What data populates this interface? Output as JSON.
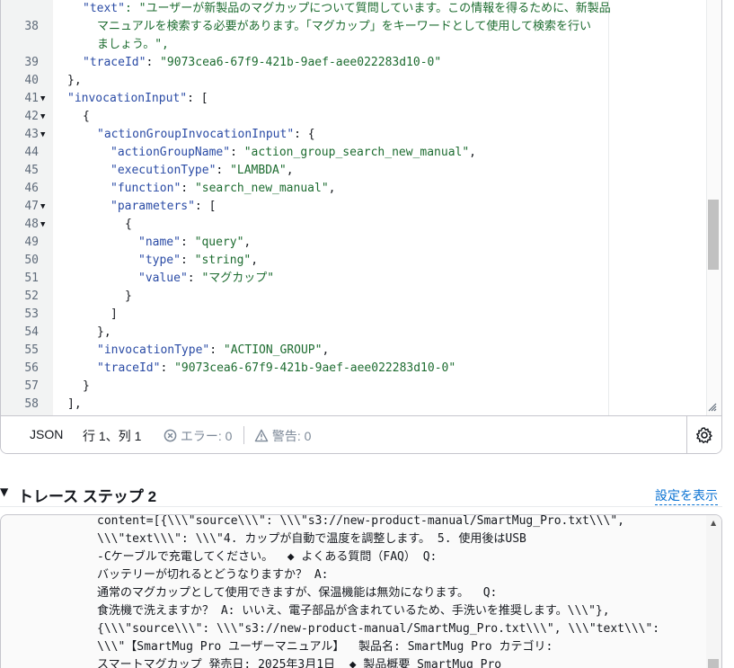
{
  "editor": {
    "wrapped_text_key": "\"text\"",
    "wrapped_text_1": ": \"ユーザーが新製品のマグカップについて質問しています。この情報を得るために、新製品",
    "wrapped_text_2": "マニュアルを検索する必要があります。「マグカップ」をキーワードとして使用して検索を行い",
    "wrapped_text_3": "ましょう。\",",
    "lines": [
      {
        "n": "38",
        "fold": ""
      },
      {
        "n": "39",
        "fold": "",
        "key": "\"traceId\"",
        "sep": ": ",
        "val": "\"9073cea6-67f9-421b-9aef-aee022283d10-0\"",
        "tail": ""
      },
      {
        "n": "40",
        "fold": "",
        "punct": "},"
      },
      {
        "n": "41",
        "fold": "▼",
        "key": "\"invocationInput\"",
        "sep": ": [",
        "val": "",
        "tail": ""
      },
      {
        "n": "42",
        "fold": "▼",
        "punct": "{"
      },
      {
        "n": "43",
        "fold": "▼",
        "key": "\"actionGroupInvocationInput\"",
        "sep": ": {",
        "val": "",
        "tail": ""
      },
      {
        "n": "44",
        "fold": "",
        "key": "\"actionGroupName\"",
        "sep": ": ",
        "val": "\"action_group_search_new_manual\"",
        "tail": ","
      },
      {
        "n": "45",
        "fold": "",
        "key": "\"executionType\"",
        "sep": ": ",
        "val": "\"LAMBDA\"",
        "tail": ","
      },
      {
        "n": "46",
        "fold": "",
        "key": "\"function\"",
        "sep": ": ",
        "val": "\"search_new_manual\"",
        "tail": ","
      },
      {
        "n": "47",
        "fold": "▼",
        "key": "\"parameters\"",
        "sep": ": [",
        "val": "",
        "tail": ""
      },
      {
        "n": "48",
        "fold": "▼",
        "punct": "{"
      },
      {
        "n": "49",
        "fold": "",
        "key": "\"name\"",
        "sep": ": ",
        "val": "\"query\"",
        "tail": ","
      },
      {
        "n": "50",
        "fold": "",
        "key": "\"type\"",
        "sep": ": ",
        "val": "\"string\"",
        "tail": ","
      },
      {
        "n": "51",
        "fold": "",
        "key": "\"value\"",
        "sep": ": ",
        "val": "\"マグカップ\"",
        "tail": ""
      },
      {
        "n": "52",
        "fold": "",
        "punct": "}"
      },
      {
        "n": "53",
        "fold": "",
        "punct": "]"
      },
      {
        "n": "54",
        "fold": "",
        "punct": "},"
      },
      {
        "n": "55",
        "fold": "",
        "key": "\"invocationType\"",
        "sep": ": ",
        "val": "\"ACTION_GROUP\"",
        "tail": ","
      },
      {
        "n": "56",
        "fold": "",
        "key": "\"traceId\"",
        "sep": ": ",
        "val": "\"9073cea6-67f9-421b-9aef-aee022283d10-0\"",
        "tail": ""
      },
      {
        "n": "57",
        "fold": "",
        "punct": "}"
      },
      {
        "n": "58",
        "fold": "",
        "punct": "],"
      }
    ]
  },
  "statusbar": {
    "mode": "JSON",
    "position": "行 1、列 1",
    "errors": "エラー: 0",
    "warnings": "警告: 0"
  },
  "trace_step": {
    "title": "トレース ステップ 2",
    "settings_link": "設定を表示",
    "log_lines": [
      "content=[{\\\\\\\"source\\\\\\\": \\\\\\\"s3://new-product-manual/SmartMug_Pro.txt\\\\\\\",",
      "\\\\\\\"text\\\\\\\": \\\\\\\"4. カップが自動で温度を調整します。 5. 使用後はUSB",
      "-Cケーブルで充電してください。  ◆ よくある質問（FAQ） Q:",
      "バッテリーが切れるとどうなりますか？ A:",
      "通常のマグカップとして使用できますが、保温機能は無効になります。  Q:",
      "食洗機で洗えますか？ A: いいえ、電子部品が含まれているため、手洗いを推奨します。\\\\\\\"},",
      "{\\\\\\\"source\\\\\\\": \\\\\\\"s3://new-product-manual/SmartMug_Pro.txt\\\\\\\", \\\\\\\"text\\\\\\\":",
      "\\\\\\\"【SmartMug Pro ユーザーマニュアル】  製品名: SmartMug Pro カテゴリ:",
      "スマートマグカップ 発売日: 2025年3月1日  ◆ 製品概要 SmartMug Pro"
    ]
  }
}
